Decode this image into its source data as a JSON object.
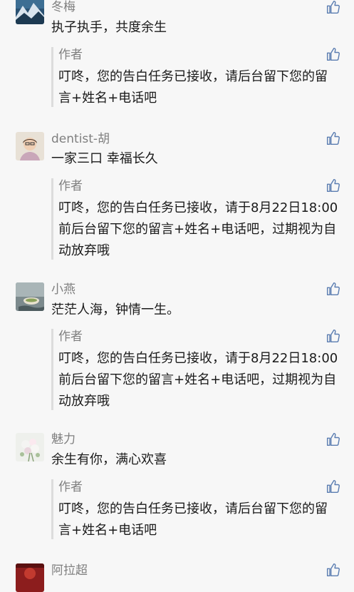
{
  "comments": [
    {
      "nickname": "冬梅",
      "text": "执子执手，共度余生",
      "reply_author": "作者",
      "reply_text": "叮咚，您的告白任务已接收，请后台留下您的留言+姓名+电话吧",
      "avatar_icon": "mountain-landscape-avatar-icon"
    },
    {
      "nickname": "dentist-胡",
      "text": "一家三口 幸福长久",
      "reply_author": "作者",
      "reply_text": "叮咚，您的告白任务已接收，请于8月22日18:00前后台留下您的留言+姓名+电话吧，过期视为自动放弃哦",
      "avatar_icon": "portrait-avatar-icon"
    },
    {
      "nickname": "小燕",
      "text": "茫茫人海，钟情一生。",
      "reply_author": "作者",
      "reply_text": "叮咚，您的告白任务已接收，请于8月22日18:00前后台留下您的留言+姓名+电话吧，过期视为自动放弃哦",
      "avatar_icon": "teacup-avatar-icon"
    },
    {
      "nickname": "魅力",
      "text": "余生有你，满心欢喜",
      "reply_author": "作者",
      "reply_text": "叮咚，您的告白任务已接收，请后台留下您的留言+姓名+电话吧",
      "avatar_icon": "flowers-avatar-icon"
    },
    {
      "nickname": "阿拉超",
      "avatar_icon": "red-avatar-icon"
    }
  ],
  "colors": {
    "background": "#f7f7f7",
    "nickname": "#7f7f7f",
    "text": "#1a1a1a",
    "like_icon": "#5b7db1",
    "reply_bar": "#dcdcdc"
  },
  "icons": {
    "like": "thumbs-up-icon"
  }
}
